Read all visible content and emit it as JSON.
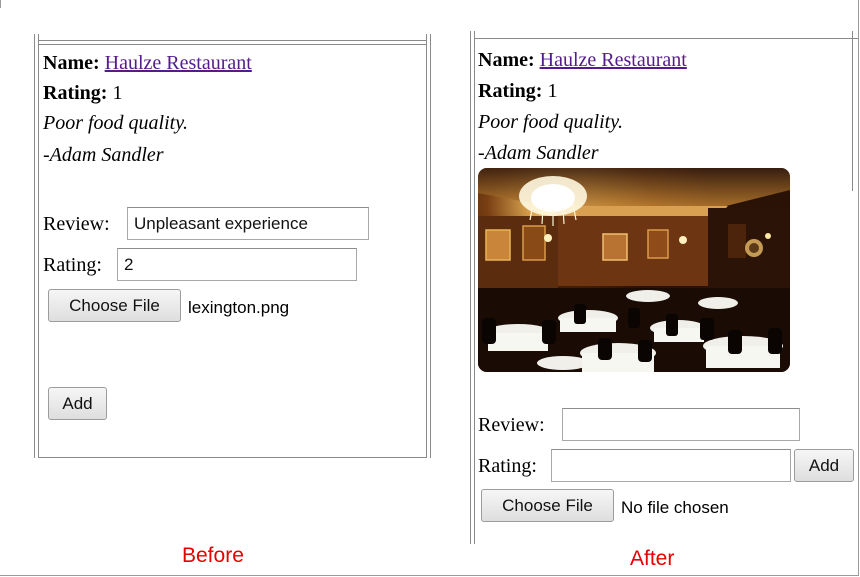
{
  "before": {
    "name_label": "Name:",
    "name_link": "Haulze Restaurant",
    "rating_label": "Rating:",
    "rating_value": "1",
    "comment": "Poor food quality.",
    "author": "-Adam Sandler",
    "review_field_label": "Review:",
    "review_field_value": "Unpleasant experience",
    "rating_field_label": "Rating:",
    "rating_field_value": "2",
    "choose_file_label": "Choose File",
    "file_name": "lexington.png",
    "add_label": "Add",
    "caption": "Before"
  },
  "after": {
    "name_label": "Name:",
    "name_link": "Haulze Restaurant",
    "rating_label": "Rating:",
    "rating_value": "1",
    "comment": "Poor food quality.",
    "author": "-Adam Sandler",
    "photo_icon": "restaurant-interior-photo",
    "review_field_label": "Review:",
    "review_field_value": "",
    "rating_field_label": "Rating:",
    "rating_field_value": "",
    "add_label": "Add",
    "choose_file_label": "Choose File",
    "file_status": "No file chosen",
    "caption": "After"
  },
  "colors": {
    "link": "#551a8b",
    "caption": "#e60000",
    "border": "#8a8a8a"
  }
}
